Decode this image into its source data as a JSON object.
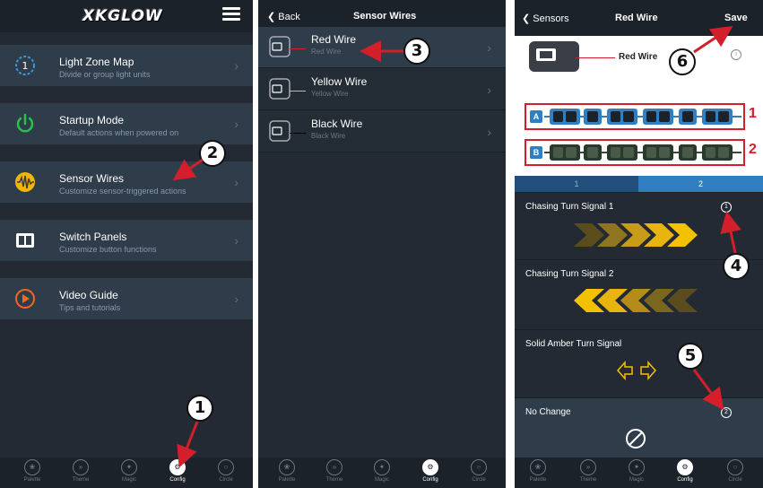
{
  "panel1": {
    "logo": "XKGLOW",
    "items": [
      {
        "title": "Light Zone Map",
        "subtitle": "Divide or group light units",
        "icon": "zone-map-icon"
      },
      {
        "title": "Startup Mode",
        "subtitle": "Default actions when powered on",
        "icon": "power-icon"
      },
      {
        "title": "Sensor Wires",
        "subtitle": "Customize sensor-triggered actions",
        "icon": "sensor-wave-icon"
      },
      {
        "title": "Switch Panels",
        "subtitle": "Customize button functions",
        "icon": "switch-panel-icon"
      },
      {
        "title": "Video Guide",
        "subtitle": "Tips and tutorials",
        "icon": "play-icon"
      }
    ]
  },
  "panel2": {
    "back": "Back",
    "title": "Sensor Wires",
    "wires": [
      {
        "title": "Red Wire",
        "subtitle": "Red Wire",
        "color": "#d21f2b"
      },
      {
        "title": "Yellow Wire",
        "subtitle": "Yellow Wire",
        "color": "#f2c200"
      },
      {
        "title": "Black Wire",
        "subtitle": "Black Wire",
        "color": "#000000"
      }
    ]
  },
  "panel3": {
    "back": "Sensors",
    "title": "Red Wire",
    "save": "Save",
    "wire_label": "Red Wire",
    "zone_a": "A",
    "zone_b": "B",
    "row1_num": "1",
    "row2_num": "2",
    "segment_tabs": [
      "1",
      "2"
    ],
    "effects": [
      {
        "name": "Chasing Turn Signal 1",
        "badge": "1"
      },
      {
        "name": "Chasing Turn Signal 2",
        "badge": ""
      },
      {
        "name": "Solid Amber Turn Signal",
        "badge": ""
      },
      {
        "name": "No Change",
        "badge": "2"
      }
    ]
  },
  "tabbar": [
    "Palette",
    "Theme",
    "Magic",
    "Config",
    "Circle"
  ],
  "callouts": [
    "1",
    "2",
    "3",
    "4",
    "5",
    "6"
  ],
  "colors": {
    "accent": "#2f7fc1",
    "annotation": "#d21f2b",
    "amber": "#f2b705",
    "background": "#232a33"
  }
}
